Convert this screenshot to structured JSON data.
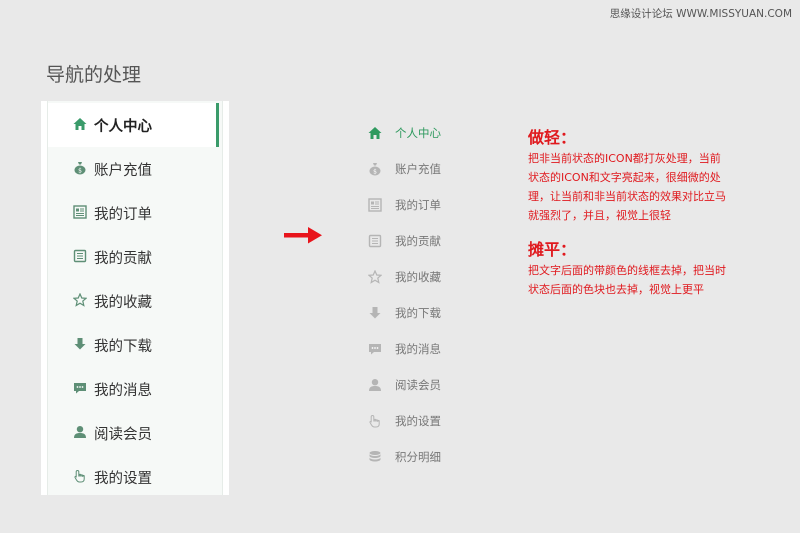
{
  "watermark": "思缘设计论坛 WWW.MISSYUAN.COM",
  "page_title": "导航的处理",
  "before_menu": {
    "items": [
      {
        "label": "个人中心",
        "icon": "home-icon",
        "active": true
      },
      {
        "label": "账户充值",
        "icon": "money-bag-icon"
      },
      {
        "label": "我的订单",
        "icon": "order-list-icon"
      },
      {
        "label": "我的贡献",
        "icon": "document-icon"
      },
      {
        "label": "我的收藏",
        "icon": "star-icon"
      },
      {
        "label": "我的下载",
        "icon": "download-icon"
      },
      {
        "label": "我的消息",
        "icon": "message-icon"
      },
      {
        "label": "阅读会员",
        "icon": "user-icon"
      },
      {
        "label": "我的设置",
        "icon": "hand-pointer-icon"
      }
    ]
  },
  "after_menu": {
    "items": [
      {
        "label": "个人中心",
        "icon": "home-icon",
        "active": true
      },
      {
        "label": "账户充值",
        "icon": "money-bag-icon"
      },
      {
        "label": "我的订单",
        "icon": "order-list-icon"
      },
      {
        "label": "我的贡献",
        "icon": "document-icon"
      },
      {
        "label": "我的收藏",
        "icon": "star-icon"
      },
      {
        "label": "我的下载",
        "icon": "download-icon"
      },
      {
        "label": "我的消息",
        "icon": "message-icon"
      },
      {
        "label": "阅读会员",
        "icon": "user-icon"
      },
      {
        "label": "我的设置",
        "icon": "hand-pointer-icon"
      },
      {
        "label": "积分明细",
        "icon": "coins-icon"
      }
    ]
  },
  "notes": {
    "light_title": "做轻：",
    "light_lines": [
      "把非当前状态的ICON都打灰处理，当前",
      "状态的ICON和文字亮起来，很细微的处",
      "理，让当前和非当前状态的效果对比立马",
      "就强烈了，并且，视觉上很轻"
    ],
    "flat_title": "摊平：",
    "flat_lines": [
      "把文字后面的带颜色的线框去掉，把当时",
      "状态后面的色块也去掉，视觉上更平"
    ]
  },
  "colors": {
    "accent_green": "#3a9b6a",
    "before_icon": "#5e8f76",
    "after_icon_inactive": "#b5b5b5",
    "note_red": "#e0191e",
    "arrow_red": "#e8141b"
  }
}
